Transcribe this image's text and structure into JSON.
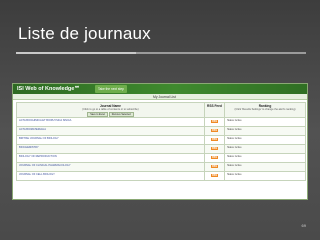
{
  "slide": {
    "title": "Liste de journaux",
    "page_number": "69"
  },
  "screenshot": {
    "logo": "ISI Web of Knowledge℠",
    "header_tab": "Take the next step",
    "header_link": "",
    "subbar_title": "My Journal List",
    "columns": {
      "title": "Journal Name",
      "title_sub": "(Click to go to a table of contents or to subscribe)",
      "title_buttons": [
        "Save to Excel",
        "Remove Selected"
      ],
      "rss": "RSS Feed",
      "rank": "Ranking",
      "rank_sub": "(Click 'Results Settings' to change the alert's ranking)"
    },
    "rows": [
      {
        "title": "ACTA BIOCHIMICA ET BIOPHYSICA SINICA",
        "rss": "RSS",
        "rank": "Status: Active"
      },
      {
        "title": "ACTA BIOMATERIALIA",
        "rss": "RSS",
        "rank": "Status: Active"
      },
      {
        "title": "BRITISH JOURNAL OF BIOLOGY",
        "rss": "RSS",
        "rank": "Status: Active"
      },
      {
        "title": "BIOCHEMISTRY",
        "rss": "RSS",
        "rank": "Status: Active"
      },
      {
        "title": "BIOLOGY OF REPRODUCTION",
        "rss": "RSS",
        "rank": "Status: Active"
      },
      {
        "title": "JOURNAL OF CLINICAL PHARMACOLOGY",
        "rss": "RSS",
        "rank": "Status: Active"
      },
      {
        "title": "JOURNAL OF CELL BIOLOGY",
        "rss": "RSS",
        "rank": "Status: Active"
      }
    ]
  }
}
